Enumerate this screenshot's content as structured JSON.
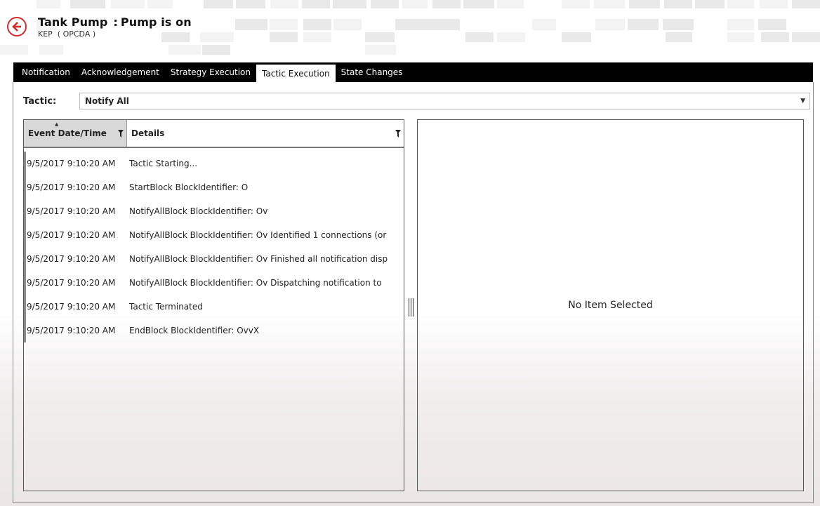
{
  "header": {
    "title_name": "Tank Pump",
    "title_separator": ":",
    "title_status": "Pump is on",
    "subtitle": "KEP  ( OPCDA )"
  },
  "tabs": [
    {
      "label": "Notification"
    },
    {
      "label": "Acknowledgement"
    },
    {
      "label": "Strategy Execution"
    },
    {
      "label": "Tactic Execution",
      "active": true
    },
    {
      "label": "State Changes"
    }
  ],
  "tactic": {
    "label": "Tactic:",
    "selected": "Notify All"
  },
  "grid": {
    "columns": [
      "Event Date/Time",
      "Details"
    ],
    "rows": [
      {
        "date": "9/5/2017 9:10:20 AM",
        "details": "Tactic Starting..."
      },
      {
        "date": "9/5/2017 9:10:20 AM",
        "details": "StartBlock BlockIdentifier: O"
      },
      {
        "date": "9/5/2017 9:10:20 AM",
        "details": "NotifyAllBlock BlockIdentifier: Ov"
      },
      {
        "date": "9/5/2017 9:10:20 AM",
        "details": "NotifyAllBlock BlockIdentifier: Ov Identified 1 connections (or"
      },
      {
        "date": "9/5/2017 9:10:20 AM",
        "details": "NotifyAllBlock BlockIdentifier: Ov Finished all notification disp"
      },
      {
        "date": "9/5/2017 9:10:20 AM",
        "details": "NotifyAllBlock BlockIdentifier: Ov Dispatching notification to"
      },
      {
        "date": "9/5/2017 9:10:20 AM",
        "details": "Tactic Terminated"
      },
      {
        "date": "9/5/2017 9:10:20 AM",
        "details": "EndBlock BlockIdentifier: OvvX"
      }
    ]
  },
  "detail_panel": {
    "empty_message": "No Item Selected"
  },
  "colors": {
    "accent": "#d42b2b",
    "tabbar": "#000000",
    "header_cell": "#d8d8d8"
  },
  "icons": {
    "back": "back-arrow-icon",
    "filter": "filter-icon",
    "dropdown": "chevron-down-icon",
    "sort": "sort-ascending-icon",
    "splitter": "splitter-grip-icon"
  }
}
